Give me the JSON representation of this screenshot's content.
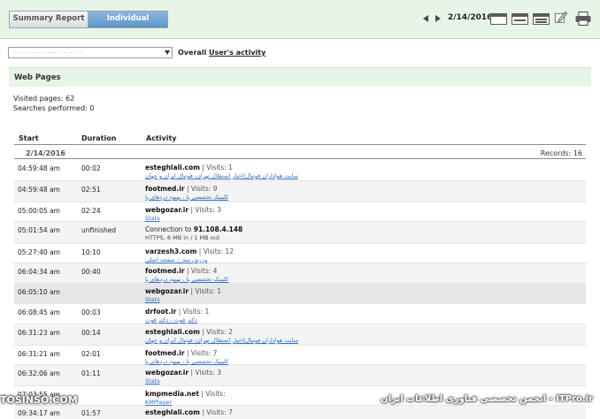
{
  "tabs": {
    "summary": "Summary Report",
    "individual": "Individual"
  },
  "nav": {
    "date": "2/14/2016"
  },
  "filter": {
    "selected_user": "··· ·· ···· · ···· · ·· ··· ·",
    "overall": "Overall",
    "users_activity": "User's activity"
  },
  "section": {
    "title": "Web Pages",
    "visited": "Visited pages: 62",
    "searches": "Searches performed: 0"
  },
  "table": {
    "headers": {
      "start": "Start",
      "duration": "Duration",
      "activity": "Activity"
    },
    "date": "2/14/2016",
    "records": "Records: 16",
    "rows": [
      {
        "start": "04:59:48 am",
        "duration": "00:02",
        "site": "esteghlali.com",
        "visits": "| Visits: 1",
        "sub": "سایت هواداران فوتبال/اخبار استقلال تهران، فوتبال ایران و جهان"
      },
      {
        "start": "04:59:48 am",
        "duration": "02:51",
        "site": "footmed.ir",
        "visits": "| Visits: 9",
        "sub": "کلینیک تخصصی پا ، بهبود دردهای پا"
      },
      {
        "start": "05:00:05 am",
        "duration": "02:24",
        "site": "webgozar.ir",
        "visits": "| Visits: 3",
        "sub": "Stats"
      },
      {
        "start": "05:01:54 am",
        "duration": "unfinished",
        "site": "91.108.4.148",
        "visits": "",
        "prefix": "Connection to",
        "sub": "HTTPS, 8 MB in / 1 MB out"
      },
      {
        "start": "05:27:40 am",
        "duration": "10:10",
        "site": "varzesh3.com",
        "visits": "| Visits: 12",
        "sub": "ورزش سه :: صفحه اصلی"
      },
      {
        "start": "06:04:34 am",
        "duration": "00:40",
        "site": "footmed.ir",
        "visits": "| Visits: 4",
        "sub": "کلینیک تخصصی پا ، بهبود دردهای پا"
      },
      {
        "start": "06:05:10 am",
        "duration": "",
        "site": "webgozar.ir",
        "visits": "| Visits: 1",
        "sub": "Stats"
      },
      {
        "start": "06:08:45 am",
        "duration": "00:03",
        "site": "drfoot.ir",
        "visits": "| Visits: 1",
        "sub": "دکتر فوت - دکتر فوت"
      },
      {
        "start": "06:31:23 am",
        "duration": "00:14",
        "site": "esteghlali.com",
        "visits": "| Visits: 2",
        "sub": "سایت هواداران فوتبال/اخبار استقلال تهران، فوتبال ایران و جهان"
      },
      {
        "start": "06:31:21 am",
        "duration": "02:01",
        "site": "footmed.ir",
        "visits": "| Visits: 7",
        "sub": "کلینیک تخصصی پا ، بهبود دردهای پا"
      },
      {
        "start": "06:32:06 am",
        "duration": "01:11",
        "site": "webgozar.ir",
        "visits": "| Visits: 3",
        "sub": "Stats"
      },
      {
        "start": "07:03:55 am",
        "duration": "",
        "site": "kmpmedia.net",
        "visits": "| Visits:",
        "sub": "KMPlayer"
      },
      {
        "start": "09:34:17 am",
        "duration": "01:57",
        "site": "esteghlali.com",
        "visits": "| Visits: 7",
        "sub": ""
      }
    ]
  },
  "watermarks": {
    "left": "TOSINSO.COM",
    "right": "ITPro.ir - انجمن تخصصی فناوری اطلاعات ایران"
  }
}
